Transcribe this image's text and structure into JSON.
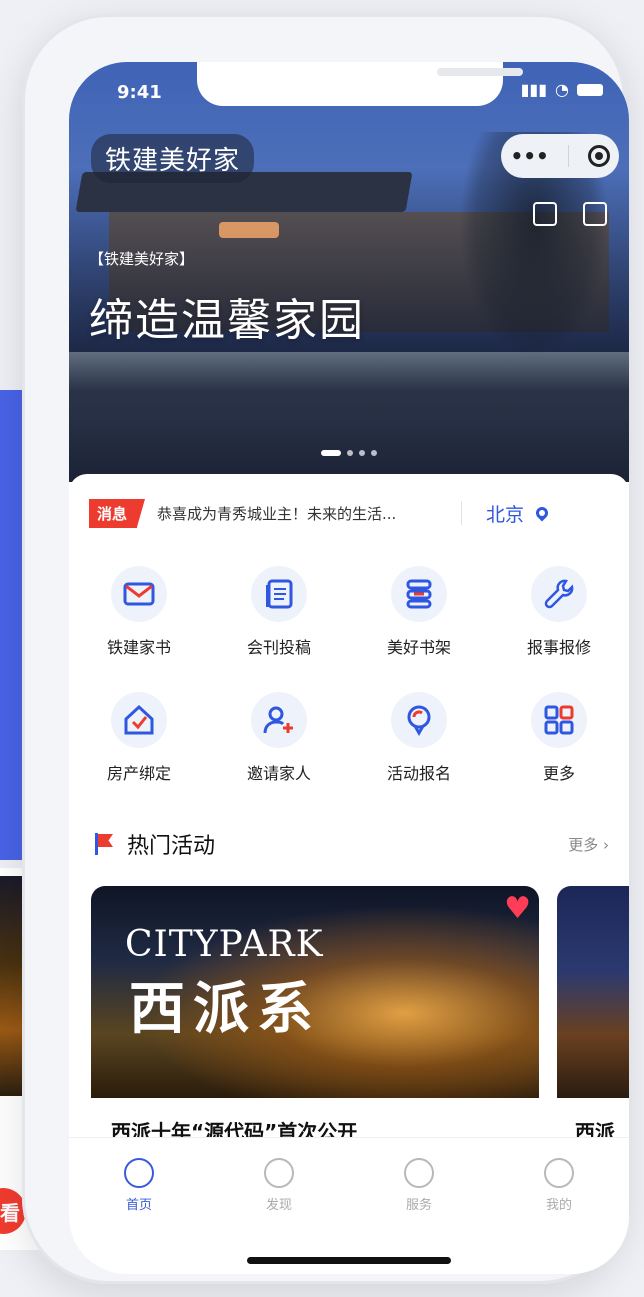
{
  "status_bar": {
    "time": "9:41"
  },
  "header": {
    "app_title": "铁建美好家",
    "capsule_more": "•••"
  },
  "hero": {
    "tag": "【铁建美好家】",
    "slogan": "缔造温馨家园"
  },
  "notice": {
    "badge": "消息",
    "text": "恭喜成为青秀城业主！未来的生活...",
    "city": "北京"
  },
  "grid": [
    {
      "label": "铁建家书",
      "icon": "mail-icon"
    },
    {
      "label": "会刊投稿",
      "icon": "document-icon"
    },
    {
      "label": "美好书架",
      "icon": "bookshelf-icon"
    },
    {
      "label": "报事报修",
      "icon": "wrench-icon"
    },
    {
      "label": "房产绑定",
      "icon": "house-check-icon"
    },
    {
      "label": "邀请家人",
      "icon": "user-plus-icon"
    },
    {
      "label": "活动报名",
      "icon": "location-pin-icon"
    },
    {
      "label": "更多",
      "icon": "grid-icon"
    }
  ],
  "section": {
    "title": "热门活动",
    "more": "更多 ›"
  },
  "cards": [
    {
      "brand": "CITYPARK",
      "brand_cn": "西派系",
      "title": "西派十年“源代码”首次公开"
    },
    {
      "title": "西派"
    }
  ],
  "left_peek": {
    "button": "看"
  },
  "tabbar": [
    {
      "label": "首页",
      "icon": "home-icon",
      "active": true
    },
    {
      "label": "发现",
      "icon": "discover-icon",
      "active": false
    },
    {
      "label": "服务",
      "icon": "heart-icon",
      "active": false
    },
    {
      "label": "我的",
      "icon": "profile-icon",
      "active": false
    }
  ],
  "colors": {
    "accent": "#2f57e0",
    "badge": "#ee3b2f",
    "heart": "#ff3d56"
  }
}
